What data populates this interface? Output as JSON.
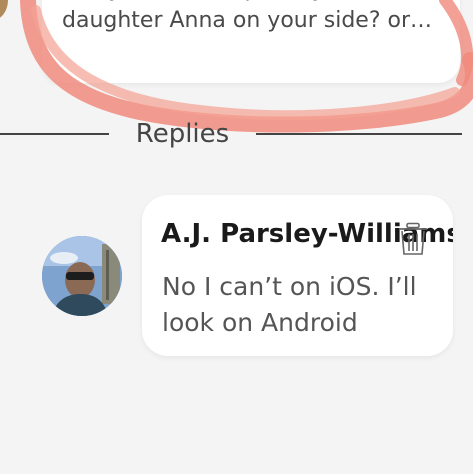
{
  "original_message": {
    "text": "can you see the pic of your\ndaughter Anna on your side? or…"
  },
  "divider": {
    "label": "Replies"
  },
  "reply": {
    "author": "A.J. Parsley-Williams",
    "text": "No I can’t on iOS. I’ll look on Android",
    "delete_icon": "trash-icon"
  },
  "colors": {
    "background": "#f4f4f4",
    "card": "#ffffff",
    "scribble": "#f08a7c",
    "divider": "#444444"
  }
}
